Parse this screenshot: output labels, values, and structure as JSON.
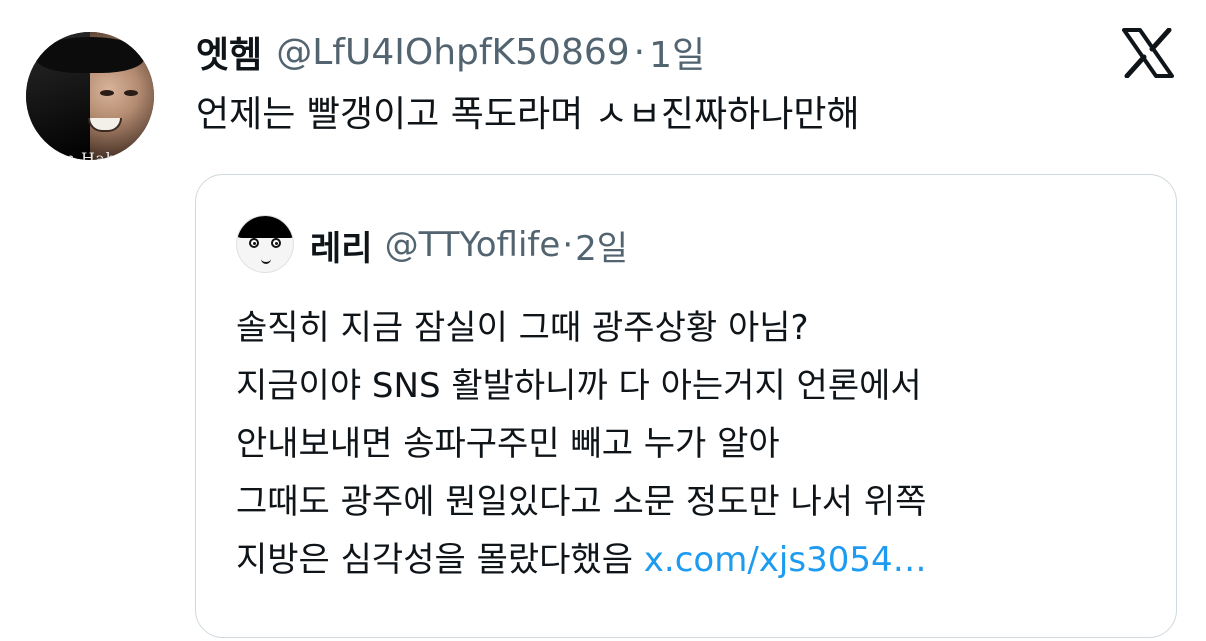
{
  "tweet": {
    "display_name": "엣헴",
    "handle": "@LfU4IOhpfK50869",
    "separator": "·",
    "time": "1일",
    "text": "언제는 빨갱이고 폭도라며 ㅅㅂ진짜하나만해",
    "avatar_text": "I'm Haha"
  },
  "logo": {
    "icon": "x-logo-icon"
  },
  "quote": {
    "display_name": "레리",
    "handle": "@TTYoflife",
    "separator": "·",
    "time": "2일",
    "lines": [
      "솔직히 지금 잠실이 그때 광주상황 아님?",
      "지금이야 SNS 활발하니까 다 아는거지 언론에서",
      "안내보내면 송파구주민 빼고 누가 알아",
      "그때도 광주에 뭔일있다고 소문 정도만 나서 위쪽",
      "지방은 심각성을 몰랐다했음 "
    ],
    "link_text": "x.com/xjs3054…"
  },
  "colors": {
    "text": "#0f1419",
    "secondary": "#536471",
    "link": "#1d9bf0",
    "border": "#cfd9de"
  }
}
